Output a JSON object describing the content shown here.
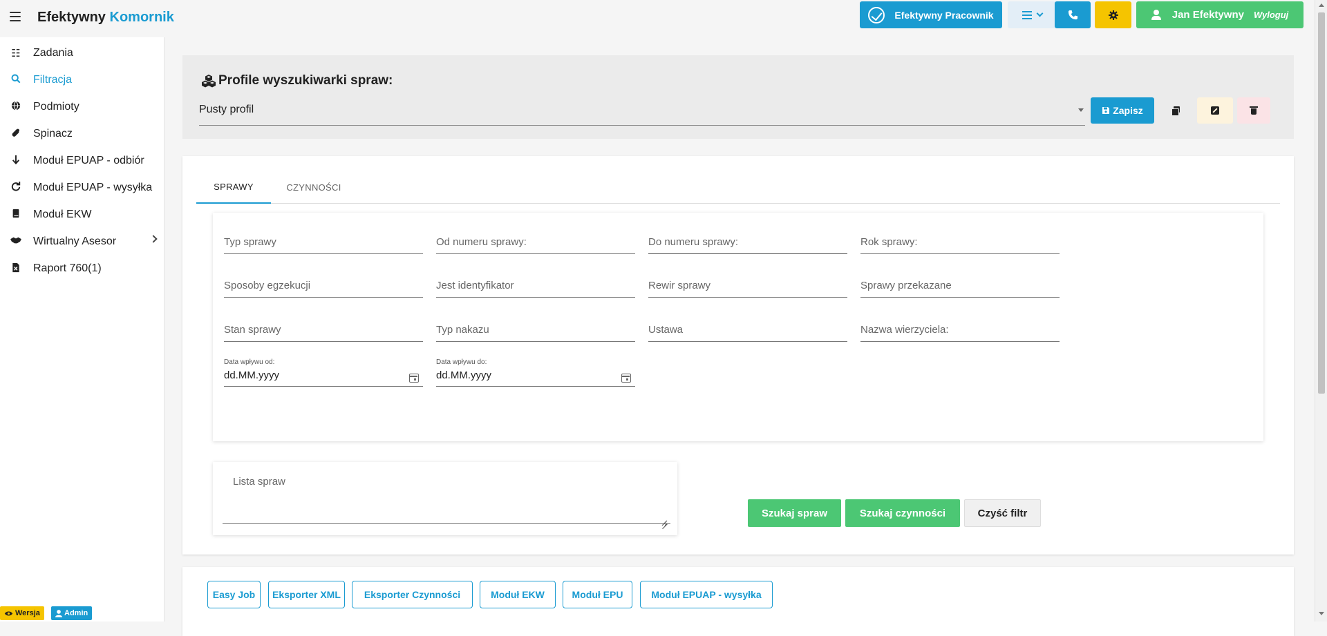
{
  "header": {
    "app_title_main": "Efektywny",
    "app_title_accent": "Komornik",
    "pracownik_label": "Efektywny Pracownik",
    "user_name": "Jan Efektywny",
    "logout_label": "Wyloguj",
    "colors": {
      "primary": "#1a9bd1",
      "warning": "#f5c400",
      "success": "#4cc774"
    }
  },
  "sidebar": {
    "items": [
      {
        "label": "Zadania",
        "icon": "list-icon"
      },
      {
        "label": "Filtracja",
        "icon": "search-icon",
        "active": true
      },
      {
        "label": "Podmioty",
        "icon": "globe-icon"
      },
      {
        "label": "Spinacz",
        "icon": "paperclip-icon"
      },
      {
        "label": "Moduł EPUAP - odbiór",
        "icon": "arrow-down-icon"
      },
      {
        "label": "Moduł EPUAP - wysyłka",
        "icon": "refresh-icon"
      },
      {
        "label": "Moduł EKW",
        "icon": "book-icon"
      },
      {
        "label": "Wirtualny Asesor",
        "icon": "handshake-icon",
        "has_submenu": true
      },
      {
        "label": "Raport 760(1)",
        "icon": "excel-file-icon"
      }
    ],
    "badges": {
      "wersja": "Wersja",
      "admin": "Admin"
    }
  },
  "profile": {
    "title": "Profile wyszukiwarki spraw:",
    "selected": "Pusty profil",
    "save_label": "Zapisz"
  },
  "tabs": [
    {
      "label": "SPRAWY",
      "active": true
    },
    {
      "label": "CZYNNOŚCI",
      "active": false
    }
  ],
  "fields": {
    "typ_sprawy": "Typ sprawy",
    "od_numeru": "Od numeru sprawy:",
    "do_numeru": "Do numeru sprawy:",
    "rok_sprawy": "Rok sprawy:",
    "sposoby_egzekucji": "Sposoby egzekucji",
    "jest_identyfikator": "Jest identyfikator",
    "rewir_sprawy": "Rewir sprawy",
    "sprawy_przekazane": "Sprawy przekazane",
    "stan_sprawy": "Stan sprawy",
    "typ_nakazu": "Typ nakazu",
    "ustawa": "Ustawa",
    "nazwa_wierzyciela": "Nazwa wierzyciela:",
    "data_od_label": "Data wpływu od:",
    "data_od_value": "dd.MM.yyyy",
    "data_do_label": "Data wpływu do:",
    "data_do_value": "dd.MM.yyyy",
    "lista_spraw": "Lista spraw"
  },
  "actions": {
    "szukaj_spraw": "Szukaj spraw",
    "szukaj_czynnosci": "Szukaj czynności",
    "czysc_filtr": "Czyść filtr"
  },
  "modules": [
    "Easy Job",
    "Eksporter XML",
    "Eksporter Czynności",
    "Moduł EKW",
    "Moduł EPU",
    "Moduł EPUAP - wysyłka"
  ]
}
